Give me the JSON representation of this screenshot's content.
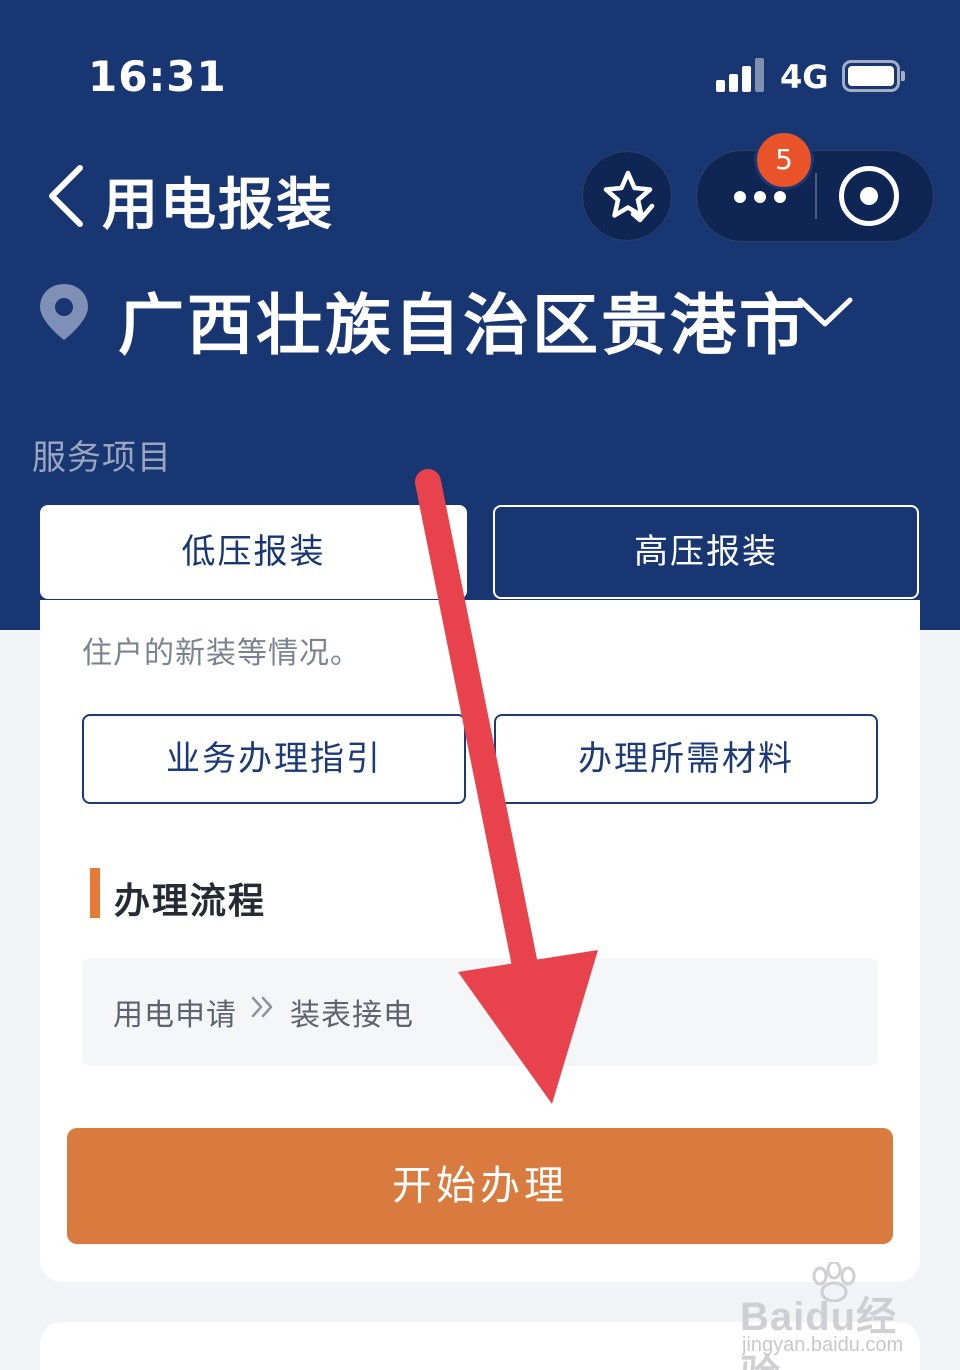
{
  "status_bar": {
    "time": "16:31",
    "network": "4G"
  },
  "nav": {
    "title": "用电报装",
    "badge_count": "5"
  },
  "location": {
    "text": "广西壮族自治区贵港市"
  },
  "services": {
    "label": "服务项目",
    "tabs": [
      {
        "label": "低压报装",
        "selected": true
      },
      {
        "label": "高压报装",
        "selected": false
      }
    ]
  },
  "card": {
    "description": "住户的新装等情况。",
    "guide_label": "业务办理指引",
    "materials_label": "办理所需材料",
    "process_heading": "办理流程",
    "steps": [
      "用电申请",
      "装表接电"
    ],
    "start_label": "开始办理"
  },
  "watermark": {
    "brand": "Baidu经验",
    "url": "jingyan.baidu.com"
  },
  "colors": {
    "header": "#173672",
    "accent": "#d97a3f",
    "marker": "#e47a35",
    "badge": "#e8532a",
    "annotation": "#e8434d"
  },
  "icons": {
    "back": "chevron-left-icon",
    "favorite": "star-check-icon",
    "more": "more-dots-icon",
    "close": "target-close-icon",
    "location": "location-pin-icon",
    "dropdown": "chevron-down-icon",
    "step_arrow": "double-chevron-right-icon"
  }
}
